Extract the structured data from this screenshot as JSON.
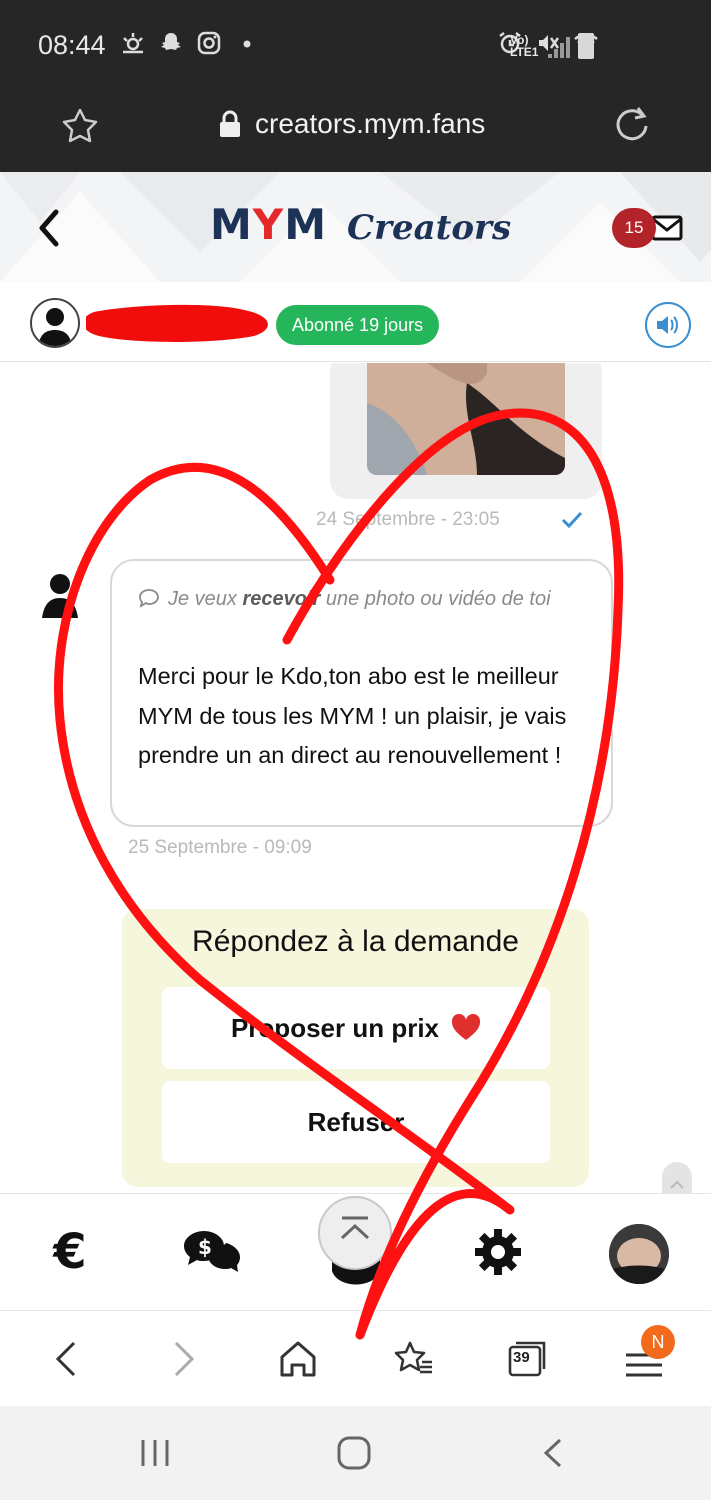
{
  "status_bar": {
    "time": "08:44",
    "network": "Vo) LTE1"
  },
  "browser": {
    "url": "creators.mym.fans",
    "tabs_count": "39",
    "menu_badge": "N"
  },
  "header": {
    "logo_mym": "MYM",
    "logo_creators": "Creators",
    "unread_count": "15"
  },
  "conversation": {
    "subscription_badge": "Abonné 19 jours",
    "media_timestamp": "24 Septembre - 23:05",
    "request_prefix": "Je veux ",
    "request_bold": "recevoir",
    "request_suffix": " une photo ou vidéo de toi",
    "message_text": "Merci pour le Kdo,ton abo est le meilleur MYM de tous les MYM ! un plaisir, je vais prendre un an direct au renouvellement !",
    "message_timestamp": "25 Septembre - 09:09"
  },
  "request_panel": {
    "title": "Répondez à la demande",
    "propose_label": "Proposer un prix",
    "refuse_label": "Refuser"
  },
  "bottom_nav": {
    "euro_symbol": "€"
  },
  "colors": {
    "brand_navy": "#1c3357",
    "brand_red": "#e5292b",
    "badge_green": "#25b55a",
    "unread_red": "#b3242a",
    "overlay_red": "#ff1111",
    "panel_yellow": "#f6f6dd"
  }
}
